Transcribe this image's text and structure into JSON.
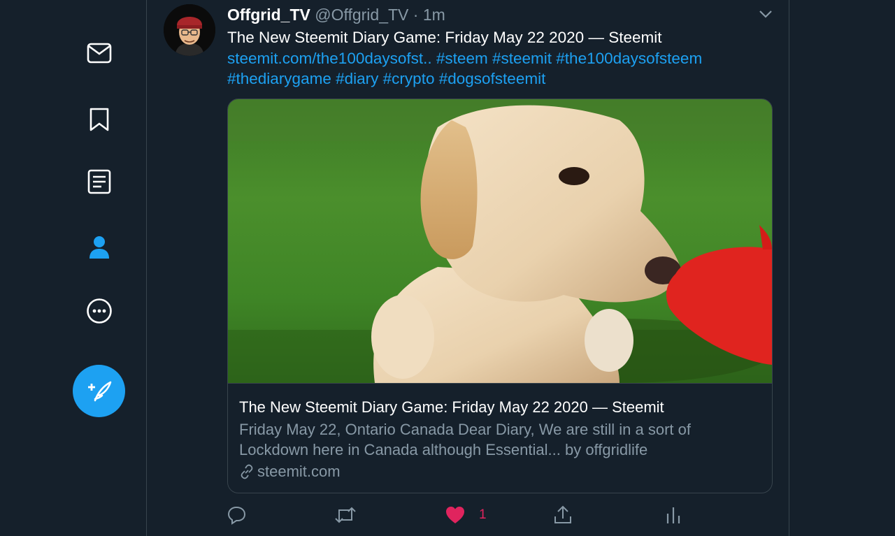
{
  "nav": {
    "items": [
      {
        "name": "messages",
        "icon": "envelope-icon"
      },
      {
        "name": "bookmarks",
        "icon": "bookmark-icon"
      },
      {
        "name": "lists",
        "icon": "list-icon"
      },
      {
        "name": "profile",
        "icon": "user-icon",
        "active": true
      },
      {
        "name": "more",
        "icon": "more-icon"
      }
    ],
    "compose_icon": "compose-tweet-icon"
  },
  "tweet": {
    "display_name": "Offgrid_TV",
    "handle": "@Offgrid_TV",
    "separator": "·",
    "time": "1m",
    "text_plain": "The New Steemit Diary Game: Friday May 22 2020 — Steemit",
    "link": "steemit.com/the100daysofst..",
    "hashtags": [
      "#steem",
      "#steemit",
      "#the100daysofsteem",
      "#thediarygame",
      "#diary",
      "#crypto",
      "#dogsofsteemit"
    ],
    "card": {
      "title": "The New Steemit Diary Game: Friday May 22 2020 — Steemit",
      "description": "Friday May 22, Ontario Canada Dear Diary, We are still in a sort of Lockdown here in Canada although Essential... by offgridlife",
      "domain": "steemit.com"
    },
    "actions": {
      "like_count": "1"
    }
  },
  "colors": {
    "background": "#15202b",
    "border": "#38444d",
    "accent": "#1da1f2",
    "muted": "#8899a6",
    "like": "#e0245e"
  }
}
